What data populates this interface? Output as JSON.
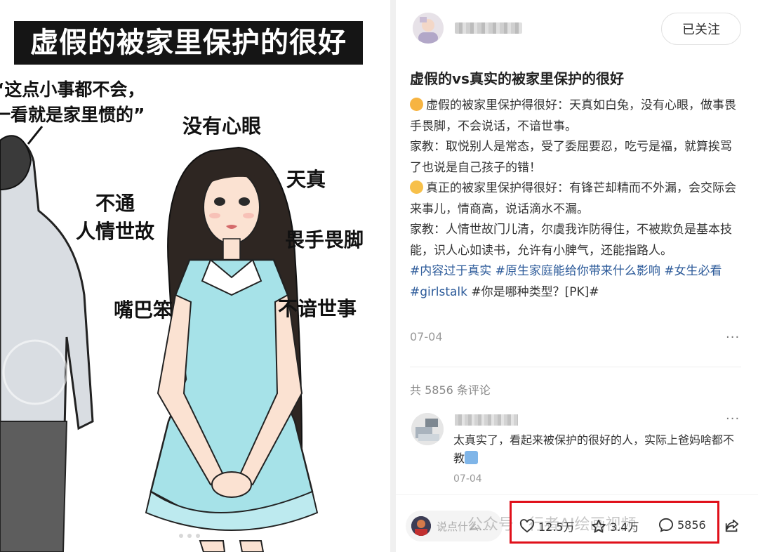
{
  "image": {
    "banner": "虚假的被家里保护的很好",
    "quote": "“这点小事都不会，\n一看就是家里惯的”",
    "labels": {
      "no_heart": "没有心眼",
      "naive": "天真",
      "no_social": "不通\n人情世故",
      "timid": "畏手畏脚",
      "clumsy_talk": "嘴巴笨",
      "unworldly": "不谙世事"
    }
  },
  "post": {
    "follow_label": "已关注",
    "title": "虚假的vs真实的被家里保护的很好",
    "lines": [
      "虚假的被家里保护得很好：天真如白兔，没有心眼，做事畏手畏脚，不会说话，不谙世事。",
      "家教：取悦别人是常态，受了委屈要忍，吃亏是福，就算挨骂了也说是自己孩子的错！",
      "真正的被家里保护得很好：有锋芒却精而不外漏，会交际会来事儿，情商高，说话滴水不漏。",
      "家教：人情世故门儿清，尔虞我诈防得住，不被欺负是基本技能，识人心如读书，允许有小脾气，还能指路人。"
    ],
    "hashtags": [
      "#内容过于真实",
      "#原生家庭能给你带来什么影响",
      "#女生必看",
      "#girlstalk"
    ],
    "hashtag_tail": "#你是哪种类型？[PK]#",
    "date": "07-04",
    "more": "···"
  },
  "comments": {
    "count_label": "共 5856 条评论",
    "items": [
      {
        "text": "太真实了，看起来被保护的很好的人，实际上爸妈啥都不教",
        "date": "07-04",
        "more": "···"
      }
    ]
  },
  "bottom_bar": {
    "input_placeholder": "说点什么...",
    "watermark": "公众号 · 行者AI绘画视频",
    "likes": "12.5万",
    "collects": "3.4万",
    "comments": "5856",
    "colors": {
      "highlight_box": "#e0101a",
      "hashtag": "#2d5b9a"
    }
  }
}
